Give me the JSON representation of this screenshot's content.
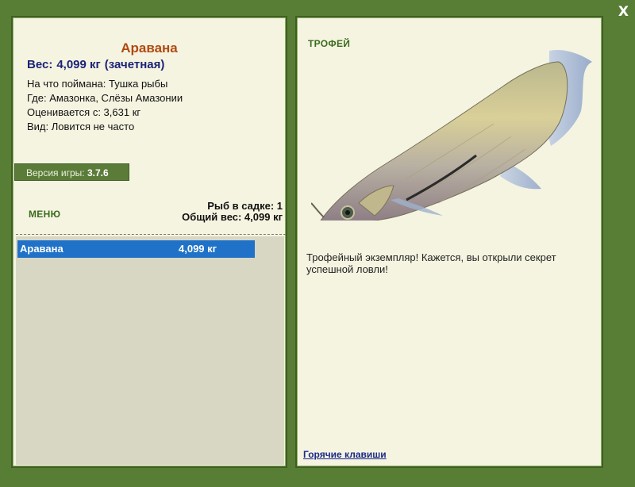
{
  "close_label": "X",
  "left": {
    "fish_name": "Аравана",
    "weight_label": "Вес:",
    "weight_value": "4,099 кг",
    "weight_note": "(зачетная)",
    "caught_on": "На что поймана: Тушка рыбы",
    "location": "Где: Амазонка, Слёзы Амазонии",
    "rated_from": "Оценивается с: 3,631 кг",
    "rarity": "Вид: Ловится не часто",
    "version_label": "Версия игры:",
    "version_value": "3.7.6",
    "menu_label": "МЕНЮ",
    "cage_count": "Рыб в садке: 1",
    "total_weight": "Общий вес: 4,099 кг",
    "list": [
      {
        "name": "Аравана",
        "weight": "4,099 кг"
      }
    ]
  },
  "right": {
    "trophy_title": "ТРОФЕЙ",
    "description": "Трофейный экземпляр! Кажется, вы открыли секрет успешной ловли!",
    "hotkeys_label": "Горячие клавиши"
  },
  "colors": {
    "background": "#587e36",
    "panel": "#f5f4e1",
    "fish_name": "#b04a12",
    "weight": "#1b2278",
    "selection": "#1f72c7",
    "menu": "#3b6b1d"
  },
  "icons": {
    "close": "close-icon",
    "trophy_image": "arowana-fish-image"
  }
}
